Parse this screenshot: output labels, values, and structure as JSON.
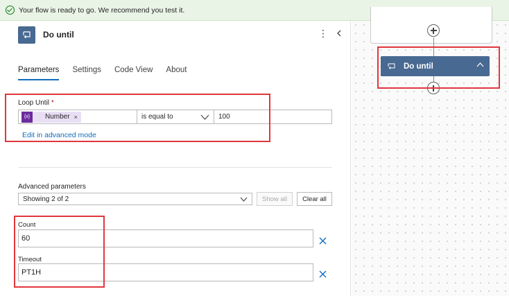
{
  "notification": {
    "text": "Your flow is ready to go. We recommend you test it."
  },
  "panel": {
    "title": "Do until",
    "tabs": [
      {
        "label": "Parameters",
        "active": true
      },
      {
        "label": "Settings",
        "active": false
      },
      {
        "label": "Code View",
        "active": false
      },
      {
        "label": "About",
        "active": false
      }
    ],
    "loop_until": {
      "label": "Loop Until",
      "required_mark": "*",
      "token_icon": "{x}",
      "token_label": "Number",
      "token_remove": "×",
      "operator": "is equal to",
      "value": "100",
      "advanced_link": "Edit in advanced mode"
    },
    "advanced": {
      "label": "Advanced parameters",
      "selected": "Showing 2 of 2",
      "show_all": "Show all",
      "clear_all": "Clear all"
    },
    "count": {
      "label": "Count",
      "value": "60"
    },
    "timeout": {
      "label": "Timeout",
      "value": "PT1H"
    }
  },
  "canvas": {
    "card_title": "Do until"
  },
  "colors": {
    "accent": "#0f6cbd",
    "action_card": "#486991",
    "highlight": "#e0363d",
    "token": "#6b2c9e",
    "notice_bg": "#e9f3e6"
  }
}
